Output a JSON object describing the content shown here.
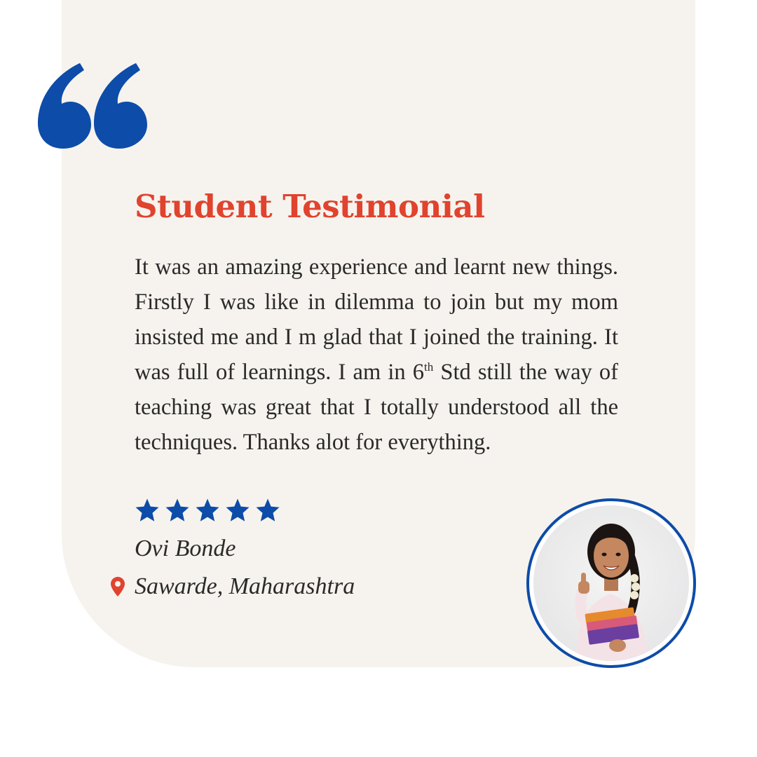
{
  "title": "Student Testimonial",
  "testimonial": {
    "before_sup": "It was an amazing experience and learnt new things. Firstly I was like in dilemma to join but my mom insisted me and I m glad that I joined the training. It was full of learnings. I am in 6",
    "sup": "th",
    "after_sup": " Std still the way of teaching was great that I totally understood all the techniques. Thanks alot for everything."
  },
  "rating": {
    "stars": 5,
    "out_of": 5
  },
  "student": {
    "name": "Ovi Bonde",
    "location": "Sawarde, Maharashtra"
  },
  "colors": {
    "accent_red": "#e0432e",
    "brand_blue": "#0d4ca8",
    "card_background": "#f6f3ee",
    "text": "#2a2a2a"
  },
  "icons": {
    "quote": "quote-open-icon",
    "star": "star-icon",
    "location": "location-pin-icon"
  }
}
